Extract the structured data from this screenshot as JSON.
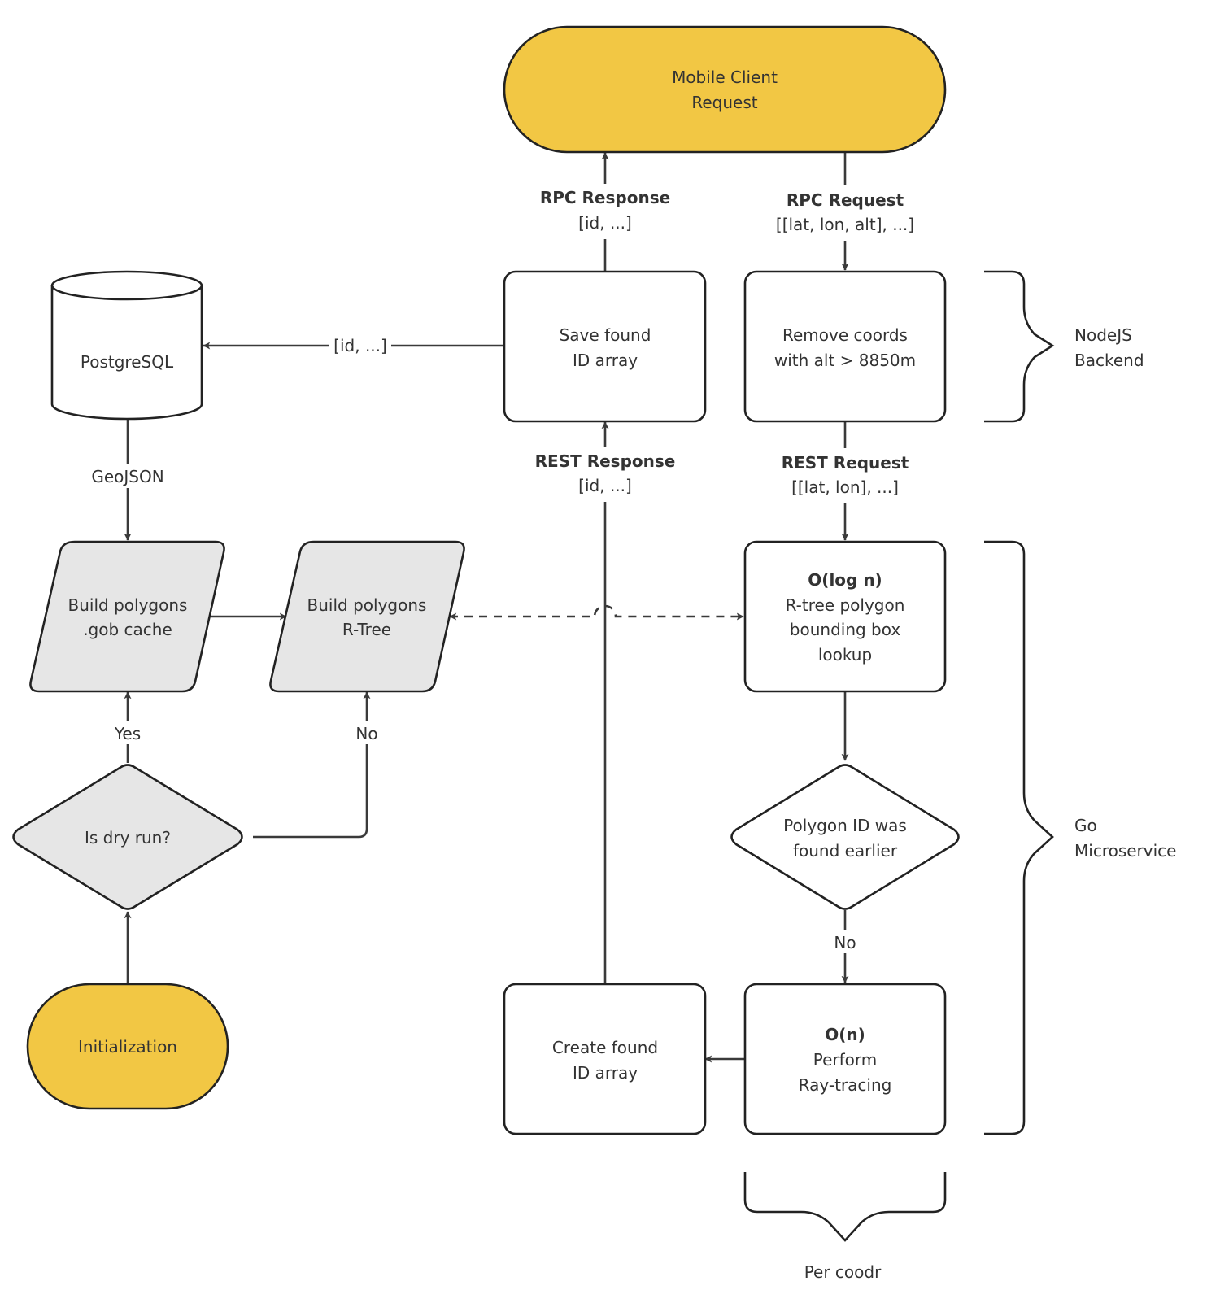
{
  "colors": {
    "terminal_fill": "#F2C744",
    "process_gray_fill": "#E6E6E6",
    "process_white_fill": "#FFFFFF",
    "stroke": "#222222",
    "text": "#333333"
  },
  "nodes": {
    "mobile_client": {
      "lines": [
        "Mobile Client",
        "Request"
      ],
      "shape": "terminal"
    },
    "save_found": {
      "lines": [
        "Save found",
        "ID array"
      ],
      "shape": "process"
    },
    "remove_coords": {
      "lines": [
        "Remove coords",
        "with alt > 8850m"
      ],
      "shape": "process"
    },
    "postgres": {
      "lines": [
        "PostgreSQL"
      ],
      "shape": "database"
    },
    "build_gob": {
      "lines": [
        "Build polygons",
        ".gob cache"
      ],
      "shape": "data"
    },
    "build_rtree": {
      "lines": [
        "Build polygons",
        "R-Tree"
      ],
      "shape": "data"
    },
    "rtree_lookup": {
      "title": "O(log n)",
      "lines": [
        "R-tree polygon",
        "bounding box",
        "lookup"
      ],
      "shape": "process"
    },
    "is_dry_run": {
      "lines": [
        "Is dry run?"
      ],
      "shape": "decision"
    },
    "polygon_found": {
      "lines": [
        "Polygon ID was",
        "found earlier"
      ],
      "shape": "decision"
    },
    "initialization": {
      "lines": [
        "Initialization"
      ],
      "shape": "terminal"
    },
    "create_found": {
      "lines": [
        "Create found",
        "ID array"
      ],
      "shape": "process"
    },
    "raytracing": {
      "title": "O(n)",
      "lines": [
        "Perform",
        "Ray-tracing"
      ],
      "shape": "process"
    }
  },
  "edge_labels": {
    "rpc_response": {
      "title": "RPC Response",
      "sub": "[id, ...]"
    },
    "rpc_request": {
      "title": "RPC Request",
      "sub": "[[lat, lon, alt], ...]"
    },
    "rest_response": {
      "title": "REST Response",
      "sub": "[id, ...]"
    },
    "rest_request": {
      "title": "REST Request",
      "sub": "[[lat, lon], ...]"
    },
    "save_to_db": "[id, ...]",
    "geojson": "GeoJSON",
    "yes": "Yes",
    "no_dry": "No",
    "no_found": "No"
  },
  "groups": {
    "nodejs": [
      "NodeJS",
      "Backend"
    ],
    "go": [
      "Go",
      "Microservice"
    ],
    "per_coord": "Per coodr"
  }
}
